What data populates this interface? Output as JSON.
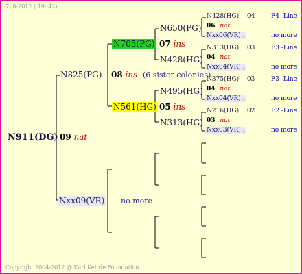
{
  "header": {
    "date": "7- 8-2012 ( 19: 42)"
  },
  "footer": {
    "copyright": "Copyright 2004-2012 @ Karl Kehrle Foundation."
  },
  "root": {
    "id": "N911(DG)",
    "year": "09",
    "tag": "nat"
  },
  "gen1": {
    "upper": {
      "id": "N825(PG)",
      "year": "08",
      "tag": "ins",
      "note": "(6 sister colonies)"
    },
    "lower": {
      "id": "Nxx09(VR)",
      "note": "no more"
    }
  },
  "gen2": {
    "a": {
      "id": "N705(PG)",
      "year": "07",
      "tag": "ins"
    },
    "b": {
      "id": "N561(HG)",
      "year": "05",
      "tag": "ins"
    }
  },
  "gen3": {
    "a": {
      "id": "N650(PG)"
    },
    "b": {
      "id": "N428(HG)"
    },
    "c": {
      "id": "N495(HG)"
    },
    "d": {
      "id": "N313(HG)"
    }
  },
  "gen4": [
    {
      "id": "N428(HG)",
      "ver": ".04",
      "line": "F4 -Line"
    },
    {
      "year": "06",
      "tag": "nat"
    },
    {
      "id": "Nxx06(VR)",
      "dot": ".",
      "line": "no more"
    },
    {
      "id": "N313(HG)",
      "ver": ".03",
      "line": "F3 -Line"
    },
    {
      "year": "04",
      "tag": "nat"
    },
    {
      "id": "Nxx04(VR)",
      "dot": ".",
      "line": "no more"
    },
    {
      "id": "N375(HG)",
      "ver": ".03",
      "line": "F3 -Line"
    },
    {
      "year": "04",
      "tag": "nat"
    },
    {
      "id": "Nxx04(VR)",
      "dot": ".",
      "line": "no more"
    },
    {
      "id": "N216(HG)",
      "ver": ".02",
      "line": "F2 -Line"
    },
    {
      "year": "03",
      "tag": "nat"
    },
    {
      "id": "Nxx03(VR)",
      "dot": ".",
      "line": "no more"
    }
  ]
}
